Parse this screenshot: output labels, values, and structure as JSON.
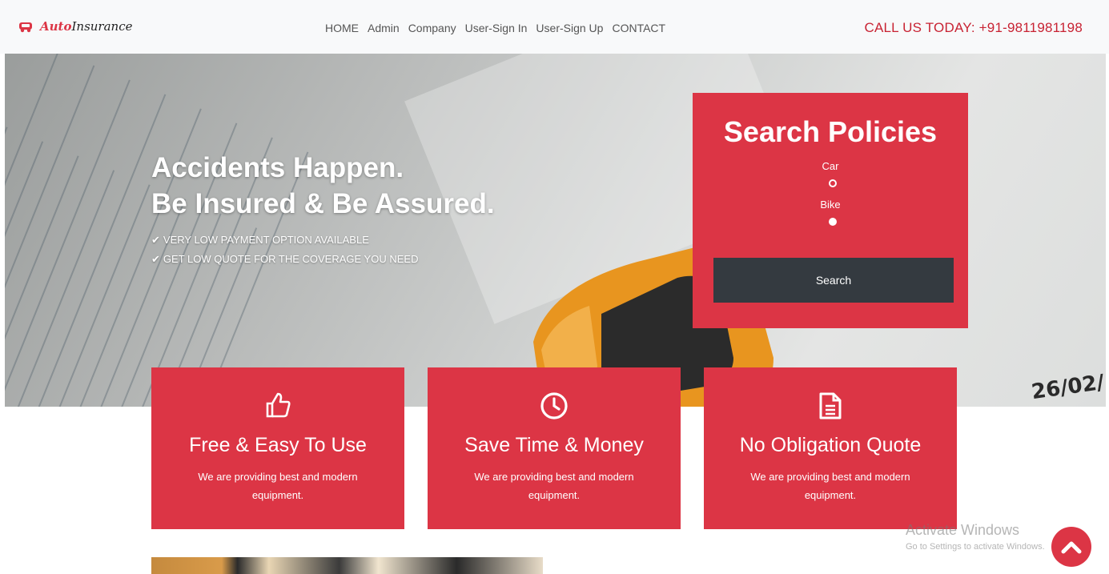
{
  "brand": {
    "logo_prefix": "Auto",
    "logo_suffix": "Insurance",
    "accent_color": "#dc3545"
  },
  "nav": {
    "items": [
      "HOME",
      "Admin",
      "Company",
      "User-Sign In",
      "User-Sign Up",
      "CONTACT"
    ]
  },
  "callus": "CALL US TODAY: +91-9811981198",
  "hero": {
    "title_line1": "Accidents Happen.",
    "title_line2": "Be Insured & Be Assured.",
    "bullets": [
      "VERY LOW PAYMENT OPTION AVAILABLE",
      "GET LOW QUOTE FOR THE COVERAGE YOU NEED"
    ],
    "photo_text": "26/02/"
  },
  "search": {
    "title": "Search Policies",
    "options": [
      {
        "label": "Car",
        "selected": false
      },
      {
        "label": "Bike",
        "selected": true
      }
    ],
    "button_label": "Search"
  },
  "features": [
    {
      "icon": "thumbs-up-icon",
      "title": "Free & Easy To Use",
      "text": "We are providing best and modern equipment."
    },
    {
      "icon": "clock-icon",
      "title": "Save Time & Money",
      "text": "We are providing best and modern equipment."
    },
    {
      "icon": "document-icon",
      "title": "No Obligation Quote",
      "text": "We are providing best and modern equipment."
    }
  ],
  "watermark": {
    "line1": "Activate Windows",
    "line2": "Go to Settings to activate Windows."
  },
  "scroll_top_icon": "chevron-up-icon"
}
